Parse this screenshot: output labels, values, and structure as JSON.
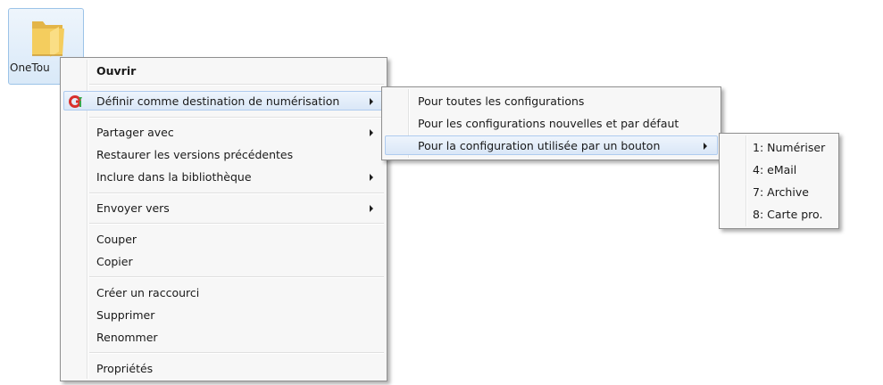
{
  "desktop": {
    "folder_label": "OneTou"
  },
  "context_menu": {
    "items": [
      {
        "label": "Ouvrir"
      },
      {
        "label": "Définir comme destination de numérisation"
      },
      {
        "label": "Partager avec"
      },
      {
        "label": "Restaurer les versions précédentes"
      },
      {
        "label": "Inclure dans la bibliothèque"
      },
      {
        "label": "Envoyer vers"
      },
      {
        "label": "Couper"
      },
      {
        "label": "Copier"
      },
      {
        "label": "Créer un raccourci"
      },
      {
        "label": "Supprimer"
      },
      {
        "label": "Renommer"
      },
      {
        "label": "Propriétés"
      }
    ]
  },
  "submenu_destination": {
    "items": [
      {
        "label": "Pour toutes les configurations"
      },
      {
        "label": "Pour les configurations nouvelles et par défaut"
      },
      {
        "label": "Pour la configuration utilisée par un bouton"
      }
    ]
  },
  "submenu_buttons": {
    "items": [
      {
        "label": "1: Numériser"
      },
      {
        "label": "4: eMail"
      },
      {
        "label": "7: Archive"
      },
      {
        "label": "8: Carte pro."
      }
    ]
  },
  "icons": {
    "folder": "folder-icon",
    "scan_destination": "scan-app-icon",
    "submenu_arrow": "chevron-right-icon"
  },
  "colors": {
    "highlight_background": "#dae7f7",
    "highlight_border": "#aecbef",
    "menu_background": "#f7f7f7",
    "folder_yellow": "#f2c85a",
    "scan_icon_red": "#d9302c",
    "scan_icon_green": "#3aa64a"
  }
}
